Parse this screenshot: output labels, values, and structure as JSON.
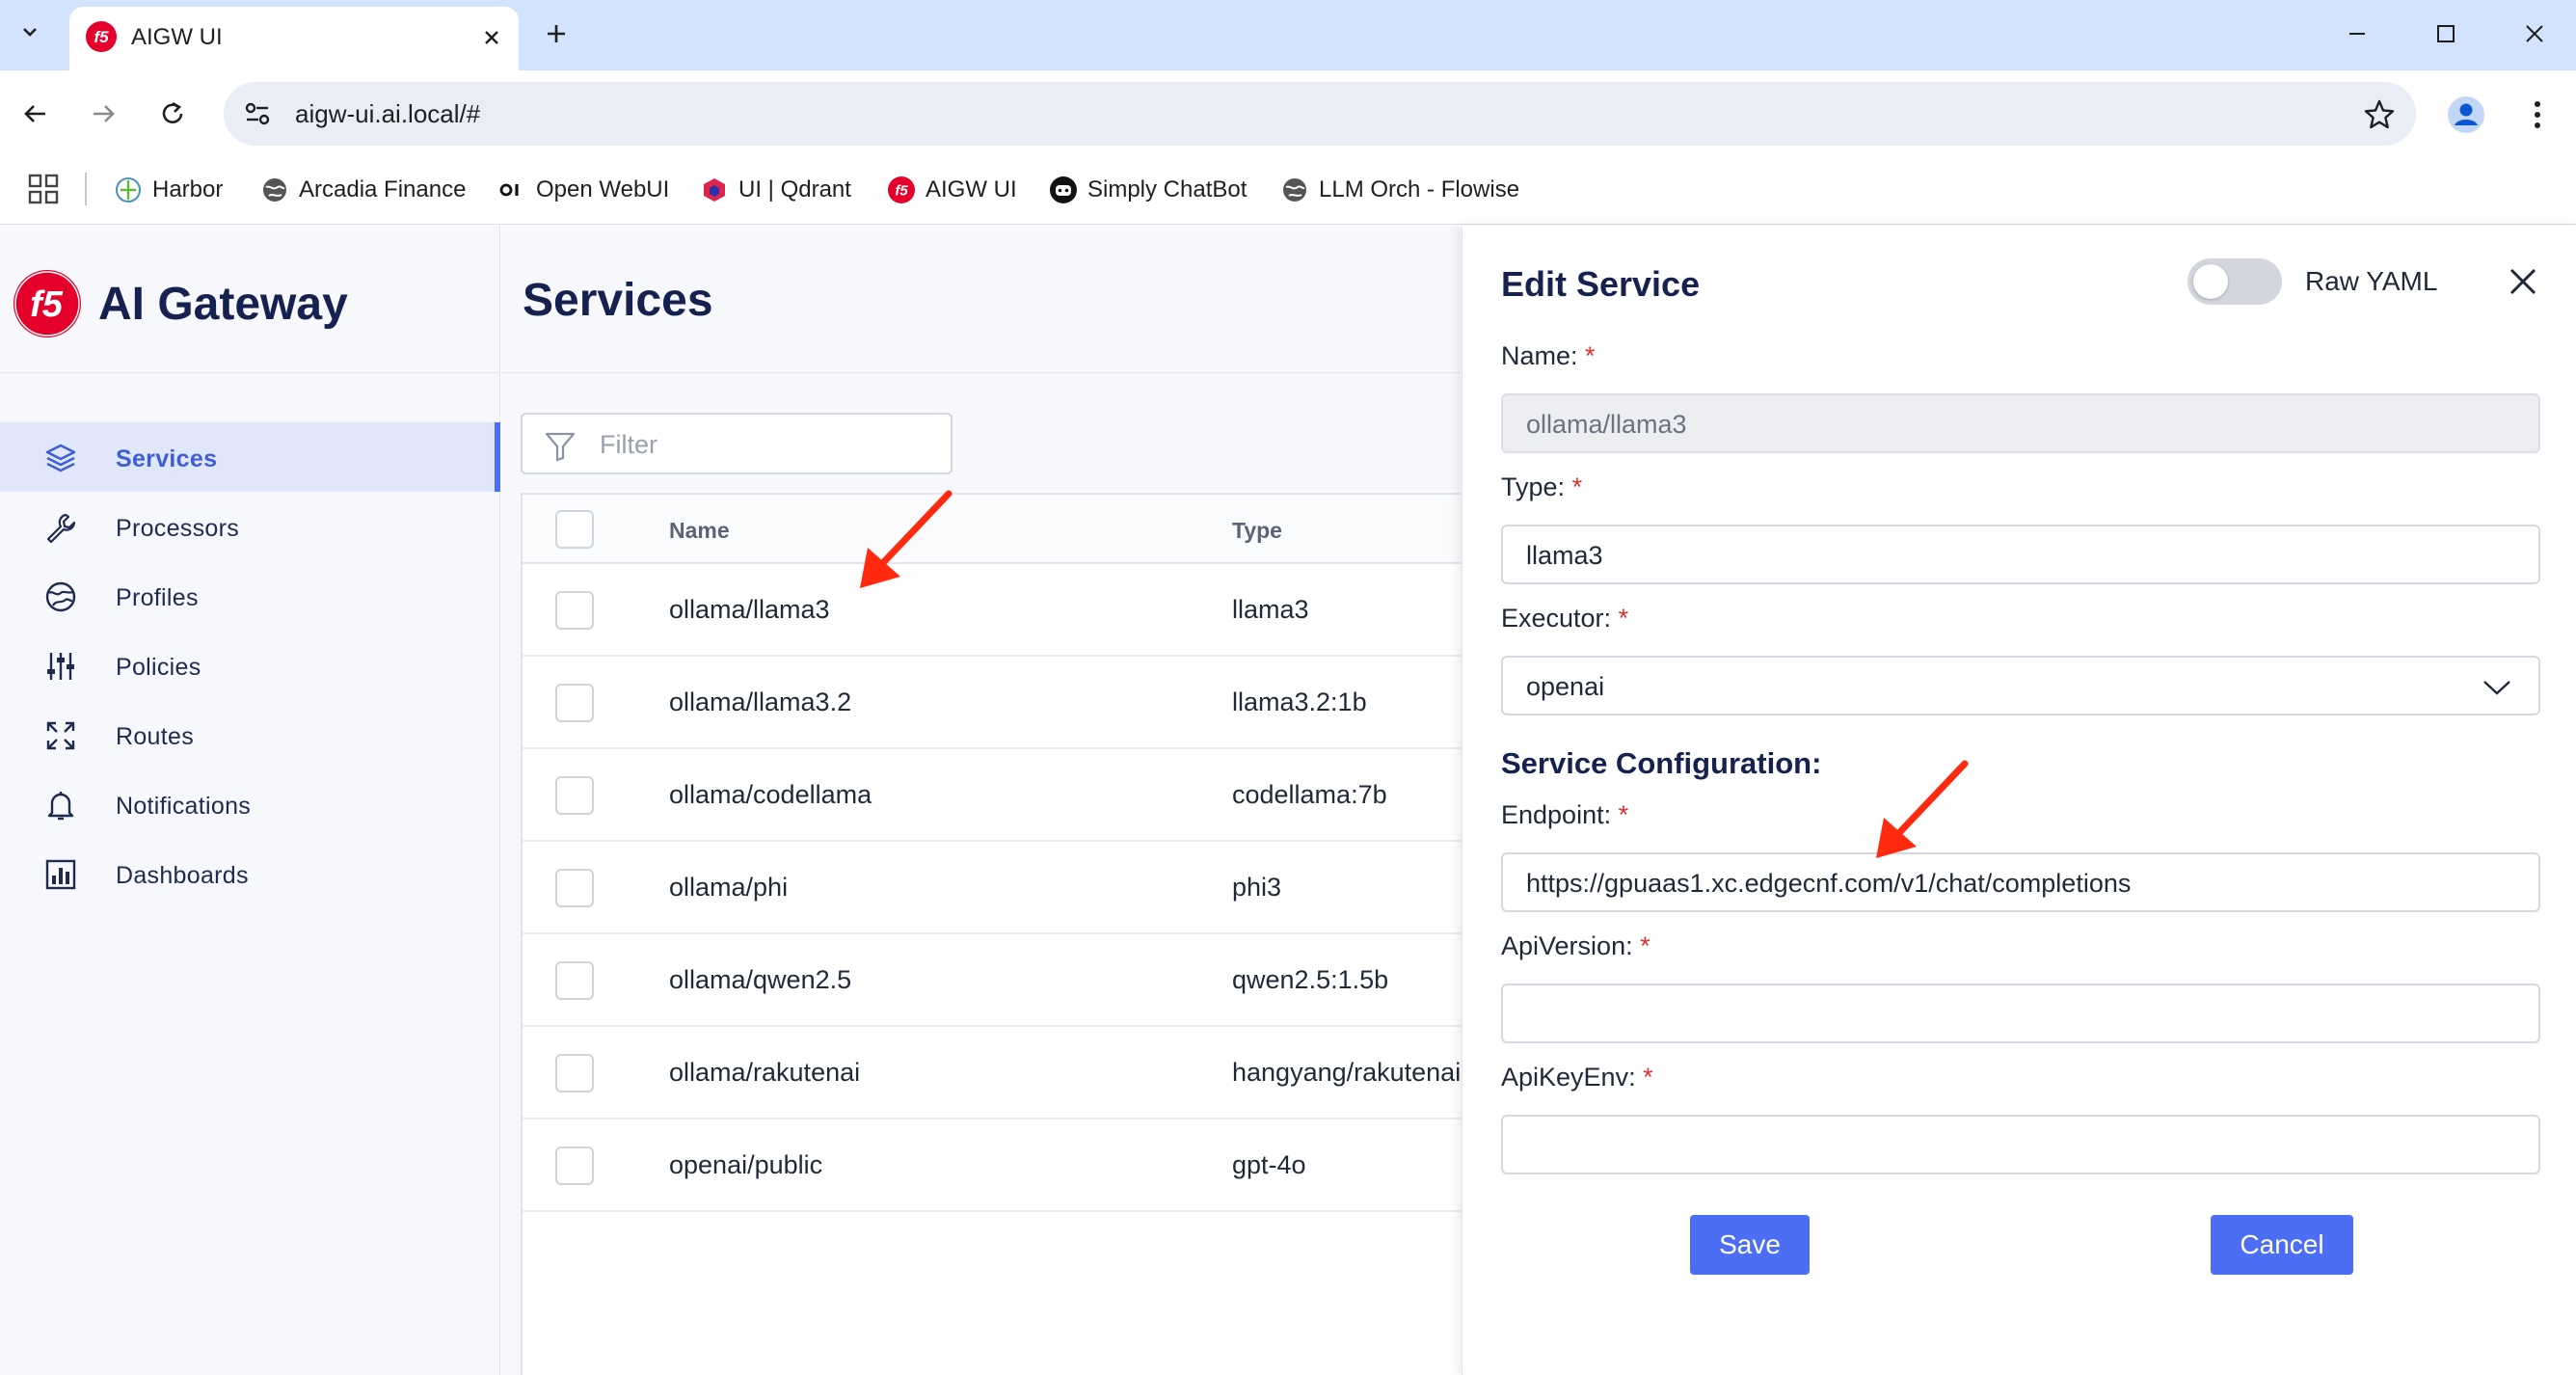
{
  "browser": {
    "tab_title": "AIGW UI",
    "url": "aigw-ui.ai.local/#",
    "bookmarks": [
      {
        "label": "Harbor",
        "icon": "harbor-icon"
      },
      {
        "label": "Arcadia Finance",
        "icon": "globe-icon"
      },
      {
        "label": "Open WebUI",
        "icon": "openwebui-icon"
      },
      {
        "label": "UI | Qdrant",
        "icon": "qdrant-icon"
      },
      {
        "label": "AIGW UI",
        "icon": "f5-icon"
      },
      {
        "label": "Simply ChatBot",
        "icon": "chatbot-icon"
      },
      {
        "label": "LLM Orch - Flowise",
        "icon": "globe-icon"
      }
    ]
  },
  "sidebar": {
    "brand": "AI Gateway",
    "items": [
      {
        "label": "Services",
        "icon": "layers-icon",
        "active": true
      },
      {
        "label": "Processors",
        "icon": "wrench-icon"
      },
      {
        "label": "Profiles",
        "icon": "globe-icon"
      },
      {
        "label": "Policies",
        "icon": "sliders-icon"
      },
      {
        "label": "Routes",
        "icon": "expand-arrows-icon"
      },
      {
        "label": "Notifications",
        "icon": "bell-icon"
      },
      {
        "label": "Dashboards",
        "icon": "bar-chart-icon"
      }
    ]
  },
  "main": {
    "title": "Services",
    "filter_placeholder": "Filter",
    "columns": [
      "Name",
      "Type"
    ],
    "rows": [
      {
        "name": "ollama/llama3",
        "type": "llama3"
      },
      {
        "name": "ollama/llama3.2",
        "type": "llama3.2:1b"
      },
      {
        "name": "ollama/codellama",
        "type": "codellama:7b"
      },
      {
        "name": "ollama/phi",
        "type": "phi3"
      },
      {
        "name": "ollama/qwen2.5",
        "type": "qwen2.5:1.5b"
      },
      {
        "name": "ollama/rakutenai",
        "type": "hangyang/rakutenai"
      },
      {
        "name": "openai/public",
        "type": "gpt-4o"
      }
    ]
  },
  "panel": {
    "title": "Edit Service",
    "raw_yaml_label": "Raw YAML",
    "raw_yaml_on": false,
    "name_label": "Name:",
    "name_value": "ollama/llama3",
    "type_label": "Type:",
    "type_value": "llama3",
    "executor_label": "Executor:",
    "executor_value": "openai",
    "section_title": "Service Configuration:",
    "endpoint_label": "Endpoint:",
    "endpoint_value": "https://gpuaas1.xc.edgecnf.com/v1/chat/completions",
    "apiversion_label": "ApiVersion:",
    "apiversion_value": "",
    "apikeyenv_label": "ApiKeyEnv:",
    "apikeyenv_value": "",
    "required_mark": "*",
    "save_label": "Save",
    "cancel_label": "Cancel"
  },
  "colors": {
    "accent": "#4c6ef5",
    "brand_red": "#e4002b",
    "annotation_arrow": "#ff2a0f"
  }
}
